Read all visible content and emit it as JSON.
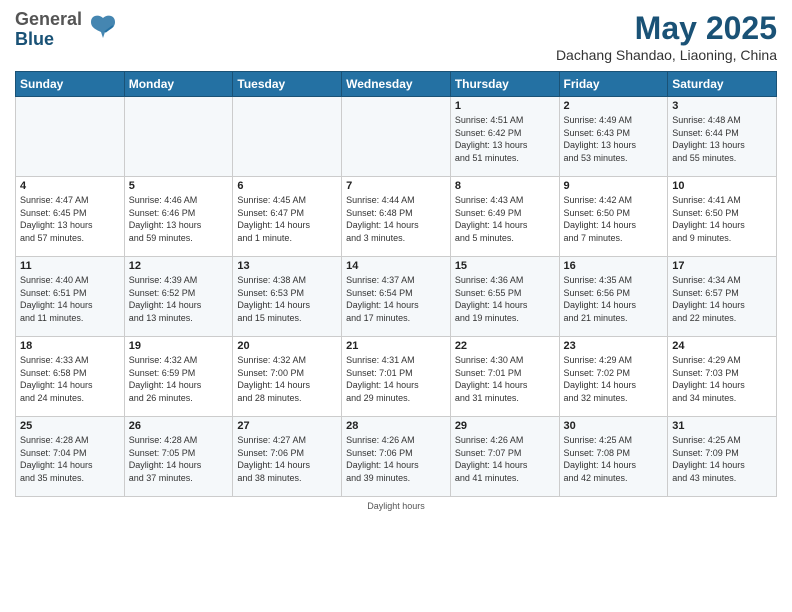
{
  "logo": {
    "general": "General",
    "blue": "Blue"
  },
  "title": {
    "month_year": "May 2025",
    "location": "Dachang Shandao, Liaoning, China"
  },
  "days_header": [
    "Sunday",
    "Monday",
    "Tuesday",
    "Wednesday",
    "Thursday",
    "Friday",
    "Saturday"
  ],
  "weeks": [
    [
      {
        "day": "",
        "content": ""
      },
      {
        "day": "",
        "content": ""
      },
      {
        "day": "",
        "content": ""
      },
      {
        "day": "",
        "content": ""
      },
      {
        "day": "1",
        "content": "Sunrise: 4:51 AM\nSunset: 6:42 PM\nDaylight: 13 hours\nand 51 minutes."
      },
      {
        "day": "2",
        "content": "Sunrise: 4:49 AM\nSunset: 6:43 PM\nDaylight: 13 hours\nand 53 minutes."
      },
      {
        "day": "3",
        "content": "Sunrise: 4:48 AM\nSunset: 6:44 PM\nDaylight: 13 hours\nand 55 minutes."
      }
    ],
    [
      {
        "day": "4",
        "content": "Sunrise: 4:47 AM\nSunset: 6:45 PM\nDaylight: 13 hours\nand 57 minutes."
      },
      {
        "day": "5",
        "content": "Sunrise: 4:46 AM\nSunset: 6:46 PM\nDaylight: 13 hours\nand 59 minutes."
      },
      {
        "day": "6",
        "content": "Sunrise: 4:45 AM\nSunset: 6:47 PM\nDaylight: 14 hours\nand 1 minute."
      },
      {
        "day": "7",
        "content": "Sunrise: 4:44 AM\nSunset: 6:48 PM\nDaylight: 14 hours\nand 3 minutes."
      },
      {
        "day": "8",
        "content": "Sunrise: 4:43 AM\nSunset: 6:49 PM\nDaylight: 14 hours\nand 5 minutes."
      },
      {
        "day": "9",
        "content": "Sunrise: 4:42 AM\nSunset: 6:50 PM\nDaylight: 14 hours\nand 7 minutes."
      },
      {
        "day": "10",
        "content": "Sunrise: 4:41 AM\nSunset: 6:50 PM\nDaylight: 14 hours\nand 9 minutes."
      }
    ],
    [
      {
        "day": "11",
        "content": "Sunrise: 4:40 AM\nSunset: 6:51 PM\nDaylight: 14 hours\nand 11 minutes."
      },
      {
        "day": "12",
        "content": "Sunrise: 4:39 AM\nSunset: 6:52 PM\nDaylight: 14 hours\nand 13 minutes."
      },
      {
        "day": "13",
        "content": "Sunrise: 4:38 AM\nSunset: 6:53 PM\nDaylight: 14 hours\nand 15 minutes."
      },
      {
        "day": "14",
        "content": "Sunrise: 4:37 AM\nSunset: 6:54 PM\nDaylight: 14 hours\nand 17 minutes."
      },
      {
        "day": "15",
        "content": "Sunrise: 4:36 AM\nSunset: 6:55 PM\nDaylight: 14 hours\nand 19 minutes."
      },
      {
        "day": "16",
        "content": "Sunrise: 4:35 AM\nSunset: 6:56 PM\nDaylight: 14 hours\nand 21 minutes."
      },
      {
        "day": "17",
        "content": "Sunrise: 4:34 AM\nSunset: 6:57 PM\nDaylight: 14 hours\nand 22 minutes."
      }
    ],
    [
      {
        "day": "18",
        "content": "Sunrise: 4:33 AM\nSunset: 6:58 PM\nDaylight: 14 hours\nand 24 minutes."
      },
      {
        "day": "19",
        "content": "Sunrise: 4:32 AM\nSunset: 6:59 PM\nDaylight: 14 hours\nand 26 minutes."
      },
      {
        "day": "20",
        "content": "Sunrise: 4:32 AM\nSunset: 7:00 PM\nDaylight: 14 hours\nand 28 minutes."
      },
      {
        "day": "21",
        "content": "Sunrise: 4:31 AM\nSunset: 7:01 PM\nDaylight: 14 hours\nand 29 minutes."
      },
      {
        "day": "22",
        "content": "Sunrise: 4:30 AM\nSunset: 7:01 PM\nDaylight: 14 hours\nand 31 minutes."
      },
      {
        "day": "23",
        "content": "Sunrise: 4:29 AM\nSunset: 7:02 PM\nDaylight: 14 hours\nand 32 minutes."
      },
      {
        "day": "24",
        "content": "Sunrise: 4:29 AM\nSunset: 7:03 PM\nDaylight: 14 hours\nand 34 minutes."
      }
    ],
    [
      {
        "day": "25",
        "content": "Sunrise: 4:28 AM\nSunset: 7:04 PM\nDaylight: 14 hours\nand 35 minutes."
      },
      {
        "day": "26",
        "content": "Sunrise: 4:28 AM\nSunset: 7:05 PM\nDaylight: 14 hours\nand 37 minutes."
      },
      {
        "day": "27",
        "content": "Sunrise: 4:27 AM\nSunset: 7:06 PM\nDaylight: 14 hours\nand 38 minutes."
      },
      {
        "day": "28",
        "content": "Sunrise: 4:26 AM\nSunset: 7:06 PM\nDaylight: 14 hours\nand 39 minutes."
      },
      {
        "day": "29",
        "content": "Sunrise: 4:26 AM\nSunset: 7:07 PM\nDaylight: 14 hours\nand 41 minutes."
      },
      {
        "day": "30",
        "content": "Sunrise: 4:25 AM\nSunset: 7:08 PM\nDaylight: 14 hours\nand 42 minutes."
      },
      {
        "day": "31",
        "content": "Sunrise: 4:25 AM\nSunset: 7:09 PM\nDaylight: 14 hours\nand 43 minutes."
      }
    ]
  ],
  "footer": {
    "daylight_hours": "Daylight hours"
  }
}
